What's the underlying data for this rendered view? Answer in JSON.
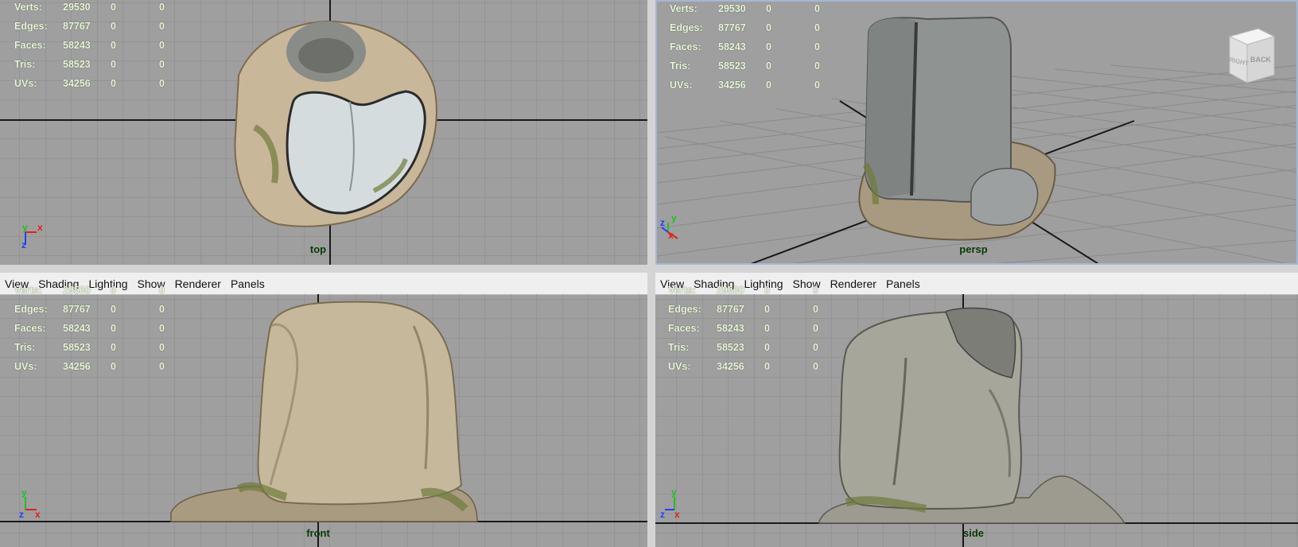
{
  "menu": [
    "View",
    "Shading",
    "Lighting",
    "Show",
    "Renderer",
    "Panels"
  ],
  "hud": {
    "rows": [
      {
        "label": "Verts:",
        "v1": "29530",
        "v2": "0",
        "v3": "0"
      },
      {
        "label": "Edges:",
        "v1": "87767",
        "v2": "0",
        "v3": "0"
      },
      {
        "label": "Faces:",
        "v1": "58243",
        "v2": "0",
        "v3": "0"
      },
      {
        "label": "Tris:",
        "v1": "58523",
        "v2": "0",
        "v3": "0"
      },
      {
        "label": "UVs:",
        "v1": "34256",
        "v2": "0",
        "v3": "0"
      }
    ]
  },
  "panels": {
    "top": {
      "camera": "top"
    },
    "persp": {
      "camera": "persp"
    },
    "front": {
      "camera": "front"
    },
    "side": {
      "camera": "side"
    }
  },
  "viewcube": {
    "face_right": "RIGHT",
    "face_back": "BACK"
  },
  "axis_labels": {
    "x": "x",
    "y": "y",
    "z": "z"
  },
  "colors": {
    "viewport_bg": "#9f9f9f",
    "grid_line": "#8a8a8a",
    "grid_axis": "#1a1a1a",
    "hud_text": "#e9f5dc",
    "camera_label": "#0a3a0a",
    "axis_x": "#e02020",
    "axis_y": "#20c020",
    "axis_z": "#2040ff"
  }
}
